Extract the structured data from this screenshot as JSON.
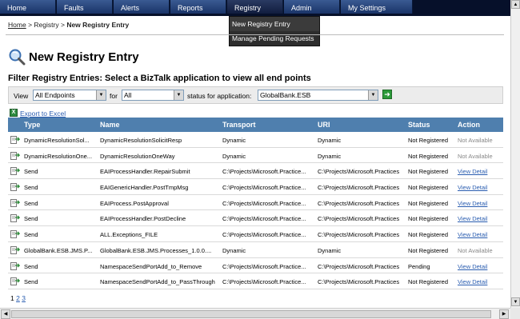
{
  "nav": {
    "tabs": [
      "Home",
      "Faults",
      "Alerts",
      "Reports",
      "Registry",
      "Admin",
      "My Settings"
    ],
    "active": "Registry"
  },
  "menu": {
    "items": [
      "New Registry Entry",
      "Manage Pending Requests"
    ]
  },
  "breadcrumb": {
    "home": "Home",
    "sep1": ">",
    "registry": "Registry",
    "sep2": ">",
    "current": "New Registry Entry"
  },
  "page": {
    "title": "New Registry Entry",
    "subtitle": "Filter Registry Entries: Select a BizTalk application to view all end points",
    "icon": "registry-search-icon"
  },
  "filter": {
    "view_label": "View",
    "view_value": "All Endpoints",
    "for_label": "for",
    "for_value": "All",
    "status_label": "status for application:",
    "app_value": "GlobalBank.ESB",
    "go_icon": "go-arrow-icon"
  },
  "export": {
    "label": "Export to Excel",
    "icon": "excel-icon"
  },
  "table": {
    "headers": [
      "Type",
      "Name",
      "Transport",
      "URI",
      "Status",
      "Action"
    ],
    "rows": [
      [
        "DynamicResolutionSol...",
        "DynamicResolutionSolicitResp",
        "Dynamic",
        "Dynamic",
        "Not Registered",
        "Not Available"
      ],
      [
        "DynamicResolutionOne...",
        "DynamicResolutionOneWay",
        "Dynamic",
        "Dynamic",
        "Not Registered",
        "Not Available"
      ],
      [
        "Send",
        "EAIProcessHandler.RepairSubmit",
        "C:\\Projects\\Microsoft.Practice...",
        "C:\\Projects\\Microsoft.Practices",
        "Not Registered",
        "View Detail"
      ],
      [
        "Send",
        "EAIGenericHandler.PostTmpMsg",
        "C:\\Projects\\Microsoft.Practice...",
        "C:\\Projects\\Microsoft.Practices",
        "Not Registered",
        "View Detail"
      ],
      [
        "Send",
        "EAIProcess.PostApproval",
        "C:\\Projects\\Microsoft.Practice...",
        "C:\\Projects\\Microsoft.Practices",
        "Not Registered",
        "View Detail"
      ],
      [
        "Send",
        "EAIProcessHandler.PostDecline",
        "C:\\Projects\\Microsoft.Practice...",
        "C:\\Projects\\Microsoft.Practices",
        "Not Registered",
        "View Detail"
      ],
      [
        "Send",
        "ALL.Exceptions_FILE",
        "C:\\Projects\\Microsoft.Practice...",
        "C:\\Projects\\Microsoft.Practices",
        "Not Registered",
        "View Detail"
      ],
      [
        "GlobalBank.ESB.JMS.P...",
        "GlobalBank.ESB.JMS.Processes_1.0.0....",
        "Dynamic",
        "Dynamic",
        "Not Registered",
        "Not Available"
      ],
      [
        "Send",
        "NamespaceSendPortAdd_to_Remove",
        "C:\\Projects\\Microsoft.Practice...",
        "C:\\Projects\\Microsoft.Practices",
        "Pending",
        "View Detail"
      ],
      [
        "Send",
        "NamespaceSendPortAdd_to_PassThrough",
        "C:\\Projects\\Microsoft.Practice...",
        "C:\\Projects\\Microsoft.Practices",
        "Not Registered",
        "View Detail"
      ]
    ]
  },
  "pager": {
    "pages": [
      "1",
      "2",
      "3"
    ],
    "current": "1"
  },
  "colors": {
    "nav_bg": "#06102a",
    "header_bg": "#4f7fae",
    "link": "#2a5db0"
  }
}
